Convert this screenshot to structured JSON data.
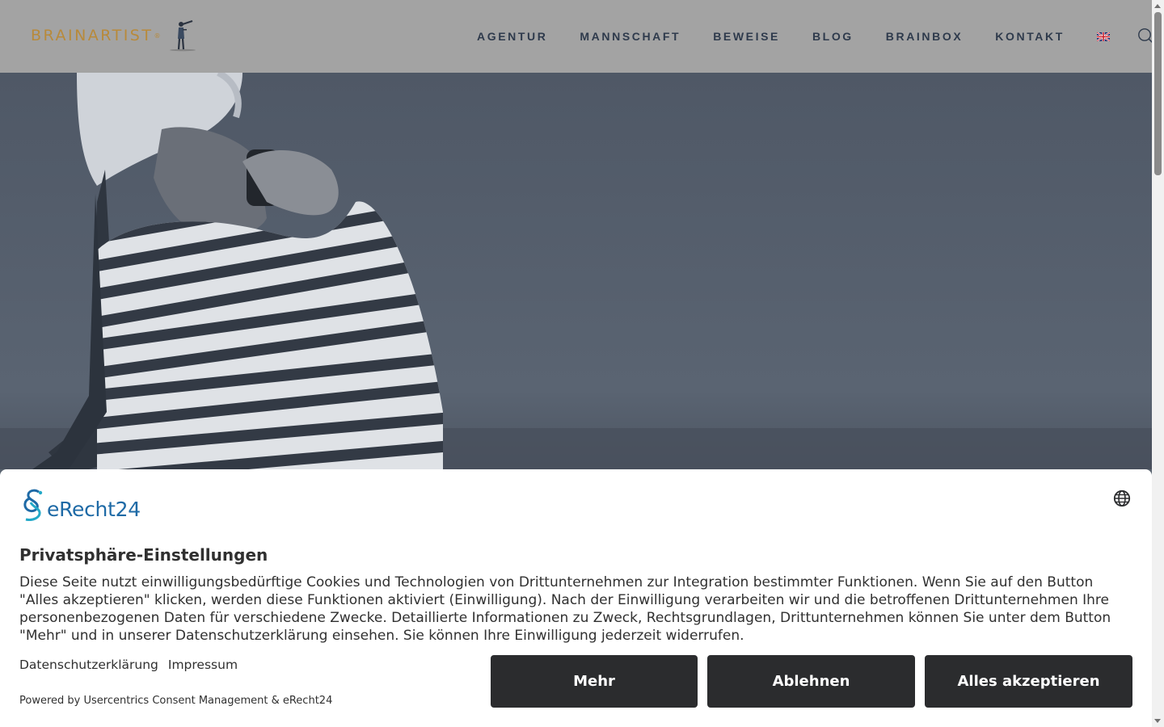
{
  "header": {
    "logo_text": "BRAINARTIST",
    "logo_mark": "®",
    "nav": [
      {
        "label": "AGENTUR"
      },
      {
        "label": "MANNSCHAFT"
      },
      {
        "label": "BEWEISE"
      },
      {
        "label": "BLOG"
      },
      {
        "label": "BRAINBOX"
      },
      {
        "label": "KONTAKT"
      }
    ],
    "language_icon": "uk-flag-icon",
    "search_icon": "search-icon"
  },
  "consent": {
    "brand": "eRecht24",
    "title": "Privatsphäre-Einstellungen",
    "body": "Diese Seite nutzt einwilligungsbedürftige Cookies und Technologien von Drittunternehmen zur Integration bestimmter Funktionen. Wenn Sie auf den Button \"Alles akzeptieren\" klicken, werden diese Funktionen aktiviert (Einwilligung). Nach der Einwilligung verarbeiten wir und die betroffenen Drittunternehmen Ihre personenbezogenen Daten für verschiedene Zwecke. Detaillierte Informationen zu Zweck, Rechtsgrundlagen, Drittunternehmen können Sie unter dem Button \"Mehr\" und in unserer Datenschutzerklärung einsehen. Sie können Ihre Einwilligung jederzeit widerrufen.",
    "links": {
      "privacy": "Datenschutzerklärung",
      "imprint": "Impressum"
    },
    "powered": "Powered by Usercentrics Consent Management & eRecht24",
    "buttons": {
      "more": "Mehr",
      "deny": "Ablehnen",
      "accept_all": "Alles akzeptieren"
    }
  },
  "colors": {
    "logo_gold": "#b88a3a",
    "nav_text": "#2e3a4c",
    "brand_blue": "#1e6aa6",
    "button_dark": "#2b2c2e"
  }
}
